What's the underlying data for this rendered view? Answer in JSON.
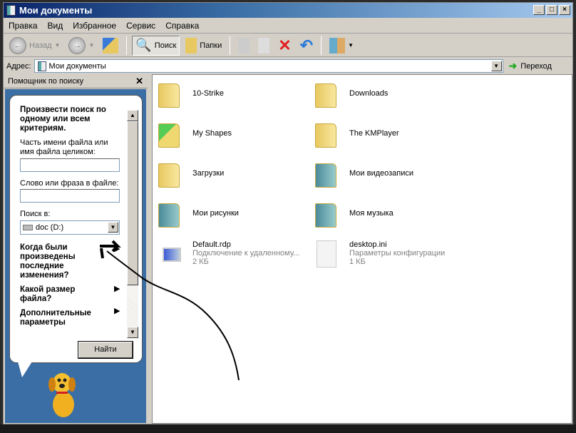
{
  "window": {
    "title": "Мои документы",
    "min": "_",
    "max": "□",
    "close": "×"
  },
  "menu": [
    "Правка",
    "Вид",
    "Избранное",
    "Сервис",
    "Справка"
  ],
  "toolbar": {
    "back": "Назад",
    "search": "Поиск",
    "folders": "Папки"
  },
  "address": {
    "label": "Адрес:",
    "value": "Мои документы",
    "go": "Переход"
  },
  "search_panel": {
    "title": "Помощник по поиску",
    "heading": "Произвести поиск по одному или всем критериям.",
    "name_label": "Часть имени файла или имя файла целиком:",
    "name_value": "",
    "phrase_label": "Слово или фраза в файле:",
    "phrase_value": "",
    "look_in_label": "Поиск в:",
    "look_in_value": "doc (D:)",
    "when_modified": "Когда были произведены последние изменения?",
    "size": "Какой размер файла?",
    "advanced": "Дополнительные параметры",
    "find_button": "Найти"
  },
  "files": [
    {
      "name": "10-Strike",
      "type": "folder"
    },
    {
      "name": "Downloads",
      "type": "folder"
    },
    {
      "name": "My Shapes",
      "type": "folder-shapes"
    },
    {
      "name": "The KMPlayer",
      "type": "folder"
    },
    {
      "name": "Загрузки",
      "type": "folder"
    },
    {
      "name": "Мои видеозаписи",
      "type": "folder-video"
    },
    {
      "name": "Мои рисунки",
      "type": "folder-pictures"
    },
    {
      "name": "Моя музыка",
      "type": "folder-music"
    },
    {
      "name": "Default.rdp",
      "desc": "Подключение к удаленному...",
      "size": "2 КБ",
      "type": "rdp"
    },
    {
      "name": "desktop.ini",
      "desc": "Параметры конфигурации",
      "size": "1 КБ",
      "type": "ini"
    }
  ]
}
